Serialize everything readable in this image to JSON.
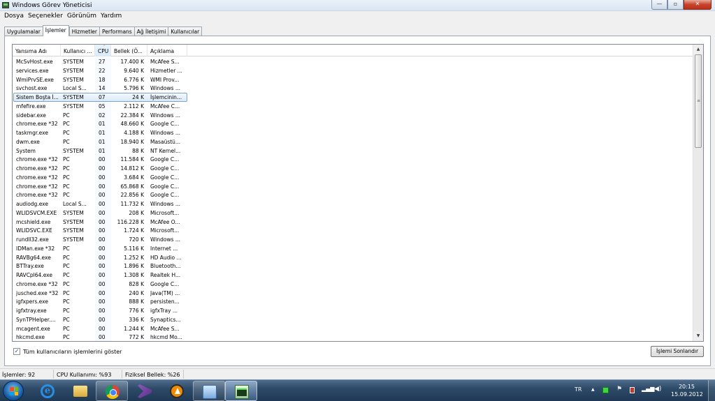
{
  "window": {
    "title": "Windows Görev Yöneticisi",
    "min_glyph": "—",
    "max_glyph": "▫",
    "close_glyph": "✕"
  },
  "menu": [
    "Dosya",
    "Seçenekler",
    "Görünüm",
    "Yardım"
  ],
  "tabs": [
    "Uygulamalar",
    "İşlemler",
    "Hizmetler",
    "Performans",
    "Ağ İletişimi",
    "Kullanıcılar"
  ],
  "active_tab": "İşlemler",
  "columns": [
    "Yansıma Adı",
    "Kullanıcı ...",
    "CPU",
    "Bellek (Ö...",
    "Açıklama"
  ],
  "sorted_column": "CPU",
  "sort_glyph": "⌃",
  "selected_row": "Sistem Boşta İ...",
  "processes": [
    [
      "McSvHost.exe",
      "SYSTEM",
      "27",
      "17.400 K",
      "McAfee S..."
    ],
    [
      "services.exe",
      "SYSTEM",
      "22",
      "9.640 K",
      "Hizmetler ..."
    ],
    [
      "WmiPrvSE.exe",
      "SYSTEM",
      "18",
      "6.776 K",
      "WMI Prov..."
    ],
    [
      "svchost.exe",
      "Local S...",
      "14",
      "5.796 K",
      "Windows ..."
    ],
    [
      "Sistem Boşta İ...",
      "SYSTEM",
      "07",
      "24 K",
      "İşlemcinin..."
    ],
    [
      "mfefire.exe",
      "SYSTEM",
      "05",
      "2.112 K",
      "McAfee C..."
    ],
    [
      "sidebar.exe",
      "PC",
      "02",
      "22.384 K",
      "Windows ..."
    ],
    [
      "chrome.exe *32",
      "PC",
      "01",
      "48.660 K",
      "Google C..."
    ],
    [
      "taskmgr.exe",
      "PC",
      "01",
      "4.188 K",
      "Windows ..."
    ],
    [
      "dwm.exe",
      "PC",
      "01",
      "18.940 K",
      "Masaüstü..."
    ],
    [
      "System",
      "SYSTEM",
      "01",
      "88 K",
      "NT Kernel..."
    ],
    [
      "chrome.exe *32",
      "PC",
      "00",
      "11.584 K",
      "Google C..."
    ],
    [
      "chrome.exe *32",
      "PC",
      "00",
      "14.812 K",
      "Google C..."
    ],
    [
      "chrome.exe *32",
      "PC",
      "00",
      "3.684 K",
      "Google C..."
    ],
    [
      "chrome.exe *32",
      "PC",
      "00",
      "65.868 K",
      "Google C..."
    ],
    [
      "chrome.exe *32",
      "PC",
      "00",
      "22.856 K",
      "Google C..."
    ],
    [
      "audiodg.exe",
      "Local S...",
      "00",
      "11.732 K",
      "Windows ..."
    ],
    [
      "WLIDSVCM.EXE",
      "SYSTEM",
      "00",
      "208 K",
      "Microsoft..."
    ],
    [
      "mcshield.exe",
      "SYSTEM",
      "00",
      "116.228 K",
      "McAfee O..."
    ],
    [
      "WLIDSVC.EXE",
      "SYSTEM",
      "00",
      "1.724 K",
      "Microsoft..."
    ],
    [
      "rundll32.exe",
      "SYSTEM",
      "00",
      "720 K",
      "Windows ..."
    ],
    [
      "IDMan.exe *32",
      "PC",
      "00",
      "5.116 K",
      "Internet ..."
    ],
    [
      "RAVBg64.exe",
      "PC",
      "00",
      "1.252 K",
      "HD Audio ..."
    ],
    [
      "BTTray.exe",
      "PC",
      "00",
      "1.896 K",
      "Bluetooth..."
    ],
    [
      "RAVCpl64.exe",
      "PC",
      "00",
      "1.308 K",
      "Realtek H..."
    ],
    [
      "chrome.exe *32",
      "PC",
      "00",
      "828 K",
      "Google C..."
    ],
    [
      "jusched.exe *32",
      "PC",
      "00",
      "240 K",
      "Java(TM) ..."
    ],
    [
      "igfxpers.exe",
      "PC",
      "00",
      "888 K",
      "persisten..."
    ],
    [
      "igfxtray.exe",
      "PC",
      "00",
      "776 K",
      "igfxTray ..."
    ],
    [
      "SynTPHelper....",
      "PC",
      "00",
      "336 K",
      "Synaptics..."
    ],
    [
      "mcagent.exe",
      "PC",
      "00",
      "1.244 K",
      "McAfee S..."
    ],
    [
      "hkcmd.exe",
      "PC",
      "00",
      "772 K",
      "hkcmd Mo..."
    ]
  ],
  "show_all_users": {
    "label": "Tüm kullanıcıların işlemlerini göster",
    "checked": true,
    "check_glyph": "✓"
  },
  "end_process_label": "İşlemi Sonlandır",
  "status": {
    "processes": "İşlemler: 92",
    "cpu": "CPU Kullanımı: %93",
    "memory": "Fiziksel Bellek: %26"
  },
  "scrollbar": {
    "up_glyph": "▲",
    "down_glyph": "▼",
    "grip_glyph": "≡"
  },
  "taskbar": {
    "ie_glyph": "e",
    "language": "TR",
    "tray_glyphs": {
      "up": "▲",
      "flag": "⚑",
      "signal": "▂▄▆",
      "volume": "◀)"
    },
    "time": "20:15",
    "date": "15.09.2012"
  }
}
